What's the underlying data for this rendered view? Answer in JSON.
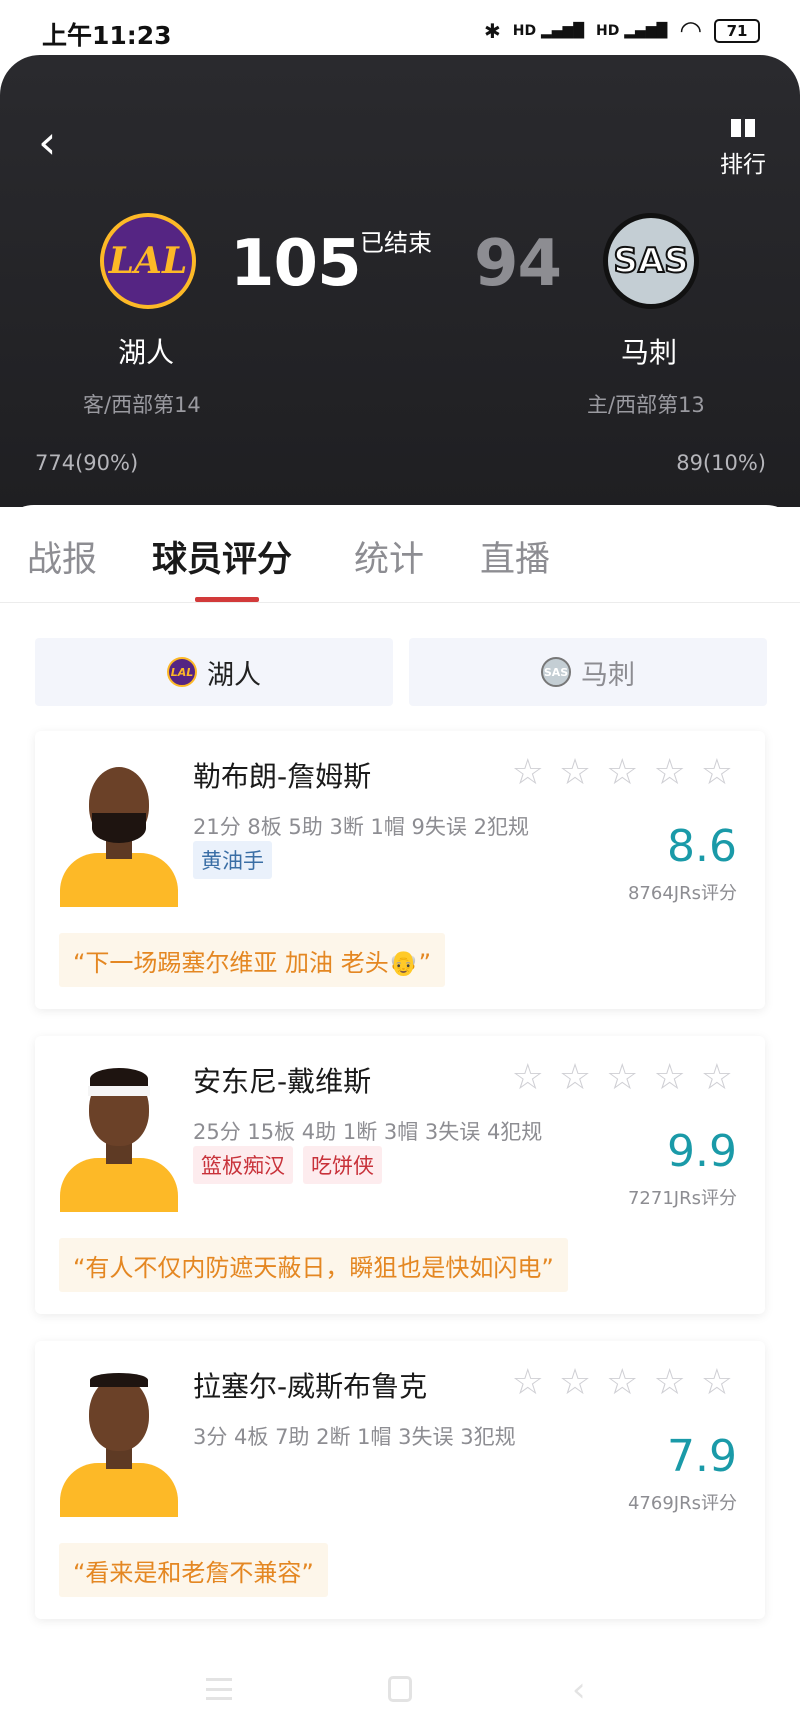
{
  "status_bar": {
    "time": "上午11:23",
    "bluetooth_icon": "✱",
    "signal_1": "HD ▂▄▆█",
    "signal_2": "HD ▂▄▆█",
    "wifi_icon": "◠",
    "battery": "71"
  },
  "header": {
    "rank_label": "排行",
    "status": "已结束",
    "home": {
      "name": "湖人",
      "logo_text": "LAL",
      "score": "105",
      "sub": "客/西部第14",
      "support": "774(90%)",
      "support_pct": 90
    },
    "away": {
      "name": "马刺",
      "logo_text": "SAS",
      "score": "94",
      "sub": "主/西部第13",
      "support": "89(10%)",
      "support_pct": 10
    },
    "colors": {
      "lakers_purple": "#552583",
      "lakers_gold": "#fdb927",
      "spurs_silver": "#c4ced4"
    }
  },
  "tabs": [
    {
      "label": "战报"
    },
    {
      "label": "球员评分"
    },
    {
      "label": "统计"
    },
    {
      "label": "直播"
    }
  ],
  "team_switch": {
    "active": {
      "label": "湖人",
      "logo": "LAL"
    },
    "inactive": {
      "label": "马刺",
      "logo": "SAS"
    }
  },
  "players": [
    {
      "name": "勒布朗-詹姆斯",
      "stats": "21分 8板 5助 3断 1帽 9失误 2犯规",
      "tags": [
        "黄油手"
      ],
      "tag_colors": [
        "blue"
      ],
      "rating": "8.6",
      "votes": "8764JRs评分",
      "comment": "“下一场踢塞尔维亚 加油 老头👴”",
      "avatar_style": "beard"
    },
    {
      "name": "安东尼-戴维斯",
      "stats": "25分 15板 4助 1断 3帽 3失误 4犯规",
      "tags": [
        "篮板痴汉",
        "吃饼侠"
      ],
      "tag_colors": [
        "red",
        "red"
      ],
      "rating": "9.9",
      "votes": "7271JRs评分",
      "comment": "“有人不仅内防遮天蔽日，瞬狙也是快如闪电”",
      "avatar_style": "headband"
    },
    {
      "name": "拉塞尔-威斯布鲁克",
      "stats": "3分 4板 7助 2断 1帽 3失误 3犯规",
      "tags": [],
      "tag_colors": [],
      "rating": "7.9",
      "votes": "4769JRs评分",
      "comment": "“看来是和老詹不兼容”",
      "avatar_style": "plain"
    }
  ],
  "icons": {
    "back": "chevron-left-icon",
    "rank": "gift-icon",
    "star": "star-outline-icon",
    "nav_menu": "menu-icon",
    "nav_home": "home-square-icon",
    "nav_back": "back-triangle-icon"
  },
  "colors": {
    "tab_indicator": "#d23a3a",
    "rating": "#1a9aa8",
    "comment_text": "#e48722",
    "comment_bg": "#fdf6ea"
  }
}
